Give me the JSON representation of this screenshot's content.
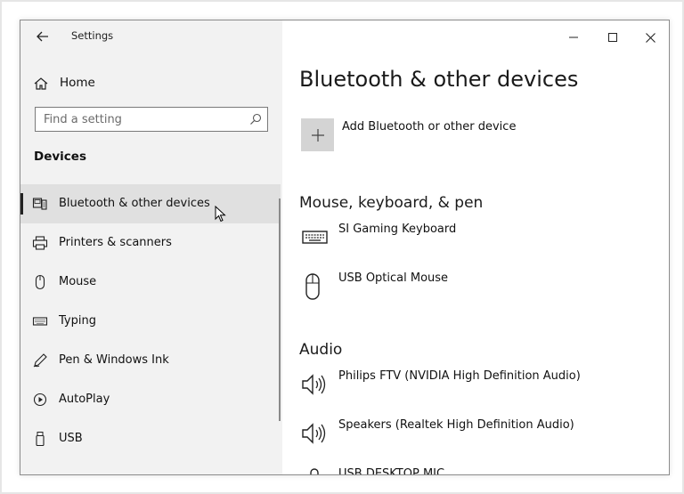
{
  "window": {
    "title": "Settings",
    "controls": {
      "minimize": "minimize",
      "maximize": "maximize",
      "close": "close"
    }
  },
  "sidebar": {
    "home_label": "Home",
    "search_placeholder": "Find a setting",
    "section_title": "Devices",
    "items": [
      {
        "label": "Bluetooth & other devices",
        "icon": "bluetooth-devices-icon",
        "active": true
      },
      {
        "label": "Printers & scanners",
        "icon": "printer-icon",
        "active": false
      },
      {
        "label": "Mouse",
        "icon": "mouse-icon",
        "active": false
      },
      {
        "label": "Typing",
        "icon": "keyboard-icon",
        "active": false
      },
      {
        "label": "Pen & Windows Ink",
        "icon": "pen-icon",
        "active": false
      },
      {
        "label": "AutoPlay",
        "icon": "autoplay-icon",
        "active": false
      },
      {
        "label": "USB",
        "icon": "usb-icon",
        "active": false
      }
    ]
  },
  "main": {
    "title": "Bluetooth & other devices",
    "add_device_label": "Add Bluetooth or other device",
    "groups": [
      {
        "title": "Mouse, keyboard, & pen",
        "devices": [
          {
            "name": "SI Gaming Keyboard",
            "icon": "keyboard-icon"
          },
          {
            "name": "USB Optical Mouse",
            "icon": "mouse-icon"
          }
        ]
      },
      {
        "title": "Audio",
        "devices": [
          {
            "name": "Philips FTV (NVIDIA High Definition Audio)",
            "icon": "speaker-icon"
          },
          {
            "name": "Speakers (Realtek High Definition Audio)",
            "icon": "speaker-icon"
          },
          {
            "name": "USB DESKTOP MIC",
            "icon": "microphone-icon"
          }
        ]
      }
    ]
  },
  "colors": {
    "sidebar_bg": "#f2f2f2",
    "active_item_bg": "#e0e0e0",
    "add_button_bg": "#d4d4d4",
    "text": "#111111"
  }
}
